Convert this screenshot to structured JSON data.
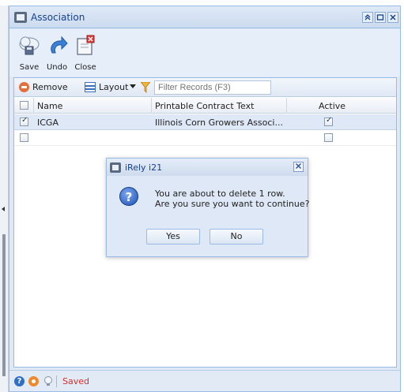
{
  "window": {
    "title": "Association"
  },
  "toolbar": {
    "save_label": "Save",
    "undo_label": "Undo",
    "close_label": "Close"
  },
  "grid_toolbar": {
    "remove_label": "Remove",
    "layout_label": "Layout",
    "filter_placeholder": "Filter Records (F3)"
  },
  "grid": {
    "columns": [
      "Name",
      "Printable Contract Text",
      "Active"
    ],
    "rows": [
      {
        "selected": true,
        "name": "ICGA",
        "printable_contract_text": "Illinois Corn Growers Associ...",
        "active": true
      },
      {
        "selected": false,
        "name": "",
        "printable_contract_text": "",
        "active": false
      }
    ]
  },
  "status_bar": {
    "status_text": "Saved"
  },
  "dialog": {
    "title": "iRely i21",
    "message_line1": "You are about to delete 1 row.",
    "message_line2": "Are you sure you want to continue?",
    "yes_label": "Yes",
    "no_label": "No"
  }
}
